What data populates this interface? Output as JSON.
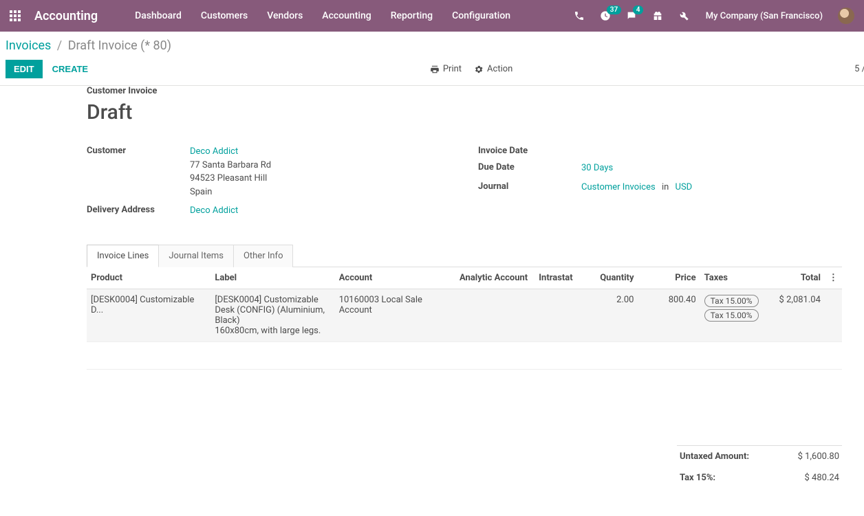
{
  "topbar": {
    "brand": "Accounting",
    "menu": [
      "Dashboard",
      "Customers",
      "Vendors",
      "Accounting",
      "Reporting",
      "Configuration"
    ],
    "activity_badge": "37",
    "chat_badge": "4",
    "company": "My Company (San Francisco)"
  },
  "breadcrumb": {
    "root": "Invoices",
    "current": "Draft Invoice (* 80)"
  },
  "buttons": {
    "edit": "EDIT",
    "create": "CREATE",
    "print": "Print",
    "action": "Action"
  },
  "pager": "5 /",
  "doc": {
    "type_label": "Customer Invoice",
    "status": "Draft",
    "customer_label": "Customer",
    "customer_name": "Deco Addict",
    "customer_addr1": "77 Santa Barbara Rd",
    "customer_addr2": "94523 Pleasant Hill",
    "customer_country": "Spain",
    "delivery_label": "Delivery Address",
    "delivery_name": "Deco Addict",
    "invdate_label": "Invoice Date",
    "duedate_label": "Due Date",
    "duedate_value": "30 Days",
    "journal_label": "Journal",
    "journal_name": "Customer Invoices",
    "journal_in": "in",
    "journal_currency": "USD"
  },
  "tabs": [
    "Invoice Lines",
    "Journal Items",
    "Other Info"
  ],
  "headers": {
    "product": "Product",
    "label": "Label",
    "account": "Account",
    "analytic": "Analytic Account",
    "intrastat": "Intrastat",
    "quantity": "Quantity",
    "price": "Price",
    "taxes": "Taxes",
    "total": "Total"
  },
  "line": {
    "product": "[DESK0004] Customizable D...",
    "label_l1": "[DESK0004] Customizable Desk (CONFIG) (Aluminium, Black)",
    "label_l2": "160x80cm, with large legs.",
    "account": "10160003 Local Sale Account",
    "quantity": "2.00",
    "price": "800.40",
    "tax1": "Tax 15.00%",
    "tax2": "Tax 15.00%",
    "total": "$ 2,081.04"
  },
  "totals": {
    "untaxed_label": "Untaxed Amount:",
    "untaxed_value": "$ 1,600.80",
    "tax_label": "Tax 15%:",
    "tax_value": "$ 480.24"
  }
}
